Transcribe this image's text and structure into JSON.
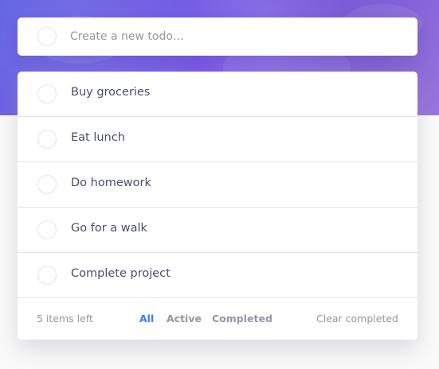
{
  "new_todo": {
    "placeholder": "Create a new todo…"
  },
  "todos": [
    {
      "label": "Buy groceries",
      "completed": false
    },
    {
      "label": "Eat lunch",
      "completed": false
    },
    {
      "label": "Do homework",
      "completed": false
    },
    {
      "label": "Go for a walk",
      "completed": false
    },
    {
      "label": "Complete project",
      "completed": false
    }
  ],
  "footer": {
    "items_left": "5 items left",
    "filters": {
      "all": "All",
      "active": "Active",
      "completed": "Completed"
    },
    "active_filter": "all",
    "clear": "Clear completed"
  },
  "colors": {
    "accent": "#3a7cfd",
    "text": "#494c6b",
    "muted": "#9495a5",
    "divider": "#e3e4f1"
  }
}
